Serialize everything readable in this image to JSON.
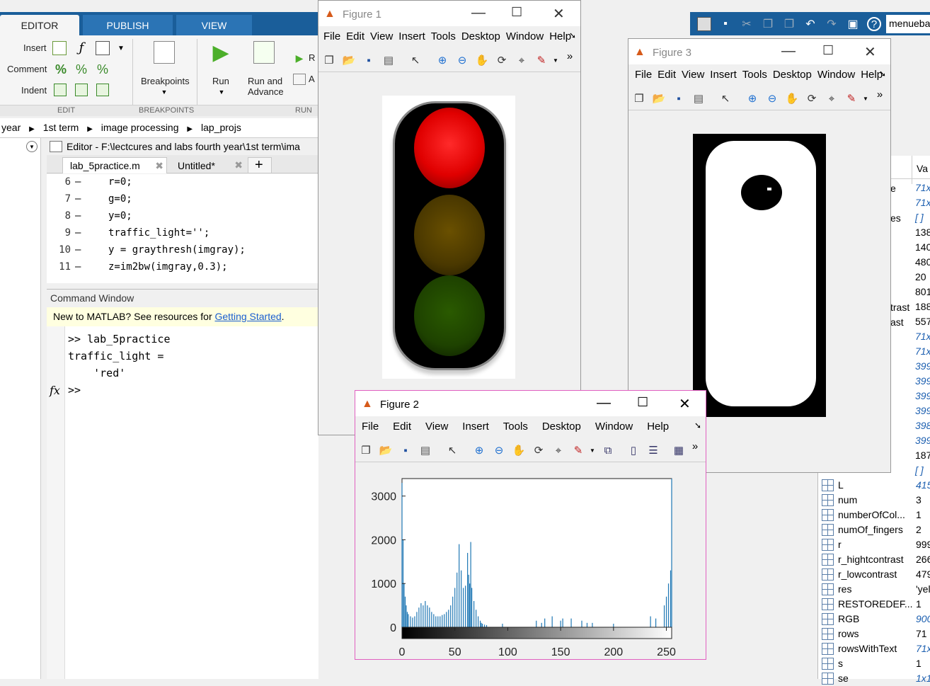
{
  "ribbon": {
    "tabs": [
      "EDITOR",
      "PUBLISH",
      "VIEW"
    ],
    "insert": "Insert",
    "comment": "Comment",
    "indent": "Indent",
    "breakpoints": "Breakpoints",
    "run": "Run",
    "run_adv_1": "Run and",
    "run_adv_2": "Advance",
    "groups": [
      "EDIT",
      "BREAKPOINTS",
      "RUN"
    ],
    "cut_r": "R",
    "cut_a": "A"
  },
  "search": {
    "value": "menueba"
  },
  "breadcrumb": [
    "year",
    "1st term",
    "image processing",
    "lap_projs"
  ],
  "editor": {
    "header": "Editor - F:\\lectcures and labs fourth year\\1st term\\ima",
    "tabs": [
      "lab_5practice.m",
      "Untitled*"
    ],
    "add_tab": "+",
    "lines": [
      {
        "n": "6",
        "text": "r=0;"
      },
      {
        "n": "7",
        "text": "g=0;"
      },
      {
        "n": "8",
        "text": "y=0;"
      },
      {
        "n": "9",
        "text": "traffic_light='';"
      },
      {
        "n": "10",
        "text": "y = graythresh(imgray);"
      },
      {
        "n": "11",
        "text": "z=im2bw(imgray,0.3);"
      }
    ]
  },
  "command": {
    "title": "Command Window",
    "banner_prefix": "New to MATLAB? See resources for ",
    "banner_link": "Getting Started",
    "banner_suffix": ".",
    "lines": [
      ">> lab_5practice",
      "traffic_light =",
      "    'red'"
    ],
    "prompt": ">>",
    "fx": "fx"
  },
  "figure1": {
    "title": "Figure 1",
    "menu": [
      "File",
      "Edit",
      "View",
      "Insert",
      "Tools",
      "Desktop",
      "Window",
      "Help"
    ]
  },
  "figure2": {
    "title": "Figure 2",
    "menu": [
      "File",
      "Edit",
      "View",
      "Insert",
      "Tools",
      "Desktop",
      "Window",
      "Help"
    ]
  },
  "figure3": {
    "title": "Figure 3",
    "menu": [
      "File",
      "Edit",
      "View",
      "Insert",
      "Tools",
      "Desktop",
      "Window",
      "Help"
    ]
  },
  "workspace": {
    "header": "Va",
    "rows": [
      {
        "name": "L",
        "value": "415"
      },
      {
        "name": "num",
        "value": "3"
      },
      {
        "name": "numberOfCol...",
        "value": "1"
      },
      {
        "name": "numOf_fingers",
        "value": "2"
      },
      {
        "name": "r",
        "value": "999"
      },
      {
        "name": "r_hightcontrast",
        "value": "266"
      },
      {
        "name": "r_lowcontrast",
        "value": "479"
      },
      {
        "name": "res",
        "value": "'yel"
      },
      {
        "name": "RESTOREDEF...",
        "value": "1"
      },
      {
        "name": "RGB",
        "value": "900"
      },
      {
        "name": "rows",
        "value": "71"
      },
      {
        "name": "rowsWithText",
        "value": "71x"
      },
      {
        "name": "s",
        "value": "1"
      },
      {
        "name": "se",
        "value": "1x1"
      }
    ],
    "partial_names": [
      "e",
      "es",
      "trast",
      "ast"
    ],
    "partial_values": [
      "71x",
      "71x",
      "[ ]",
      "138",
      "140",
      "480",
      "20",
      "801",
      "188",
      "557",
      "71x",
      "71x",
      "399",
      "399",
      "399",
      "399",
      "398",
      "399",
      "187",
      "[ ]"
    ]
  },
  "chart_data": {
    "type": "bar",
    "title": "",
    "xlabel": "",
    "ylabel": "",
    "xlim": [
      0,
      255
    ],
    "ylim": [
      0,
      3400
    ],
    "xticks": [
      "0",
      "50",
      "100",
      "150",
      "200",
      "250"
    ],
    "yticks": [
      "0",
      "1000",
      "2000",
      "3000"
    ],
    "x": [
      0,
      1,
      2,
      3,
      4,
      5,
      6,
      8,
      10,
      12,
      14,
      16,
      18,
      20,
      22,
      24,
      26,
      28,
      30,
      32,
      34,
      36,
      38,
      40,
      42,
      44,
      46,
      48,
      50,
      52,
      54,
      56,
      58,
      60,
      62,
      63,
      64,
      65,
      66,
      68,
      70,
      72,
      74,
      75,
      76,
      78,
      80,
      95,
      127,
      132,
      135,
      142,
      150,
      152,
      160,
      170,
      175,
      180,
      200,
      235,
      240,
      248,
      250,
      252,
      254,
      255
    ],
    "values": [
      3300,
      2000,
      1000,
      700,
      500,
      350,
      300,
      250,
      220,
      250,
      350,
      450,
      550,
      500,
      600,
      500,
      450,
      350,
      300,
      250,
      250,
      250,
      280,
      300,
      350,
      400,
      500,
      700,
      900,
      1250,
      1900,
      1300,
      900,
      950,
      1700,
      1200,
      1000,
      1950,
      900,
      600,
      400,
      250,
      150,
      100,
      80,
      60,
      50,
      80,
      150,
      100,
      200,
      250,
      150,
      200,
      200,
      150,
      100,
      100,
      80,
      250,
      200,
      500,
      700,
      1000,
      1300,
      3400
    ]
  }
}
